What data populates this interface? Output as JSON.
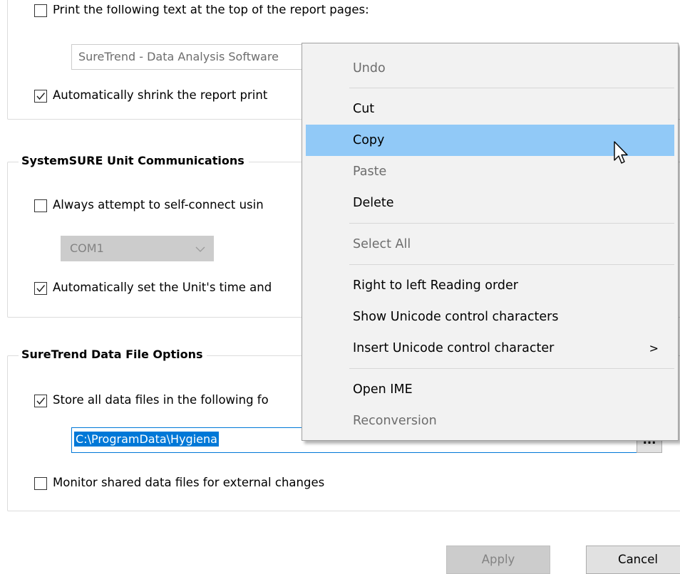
{
  "report_section": {
    "print_text_checkbox": {
      "label": "Print the following text at the top of the report pages:",
      "checked": false
    },
    "print_text_value": "SureTrend - Data Analysis Software",
    "shrink_checkbox": {
      "label": "Automatically shrink the report print",
      "checked": true
    }
  },
  "communications_section": {
    "title": "SystemSURE Unit Communications",
    "self_connect_checkbox": {
      "label": "Always attempt to self-connect usin",
      "checked": false
    },
    "com_port": {
      "selected": "COM1"
    },
    "set_time_checkbox": {
      "label": "Automatically set the Unit's time and",
      "checked": true
    }
  },
  "data_file_section": {
    "title": "SureTrend Data File Options",
    "store_checkbox": {
      "label": "Store all data files in the following fo",
      "checked": true
    },
    "folder_path": "C:\\ProgramData\\Hygiena",
    "browse_label": "...",
    "monitor_checkbox": {
      "label": "Monitor shared data files for external changes",
      "checked": false
    }
  },
  "footer": {
    "apply_label": "Apply",
    "cancel_label": "Cancel"
  },
  "context_menu": {
    "items": [
      {
        "label": "Undo",
        "enabled": false
      },
      {
        "label": "Cut",
        "enabled": true
      },
      {
        "label": "Copy",
        "enabled": true,
        "highlighted": true
      },
      {
        "label": "Paste",
        "enabled": false
      },
      {
        "label": "Delete",
        "enabled": true
      },
      {
        "label": "Select All",
        "enabled": false
      },
      {
        "label": "Right to left Reading order",
        "enabled": true
      },
      {
        "label": "Show Unicode control characters",
        "enabled": true
      },
      {
        "label": "Insert Unicode control character",
        "enabled": true,
        "submenu_arrow": ">"
      },
      {
        "label": "Open IME",
        "enabled": true
      },
      {
        "label": "Reconversion",
        "enabled": false
      }
    ]
  },
  "colors": {
    "highlight": "#91c9f7",
    "selection": "#0078d7",
    "menu_bg": "#f2f2f2"
  }
}
